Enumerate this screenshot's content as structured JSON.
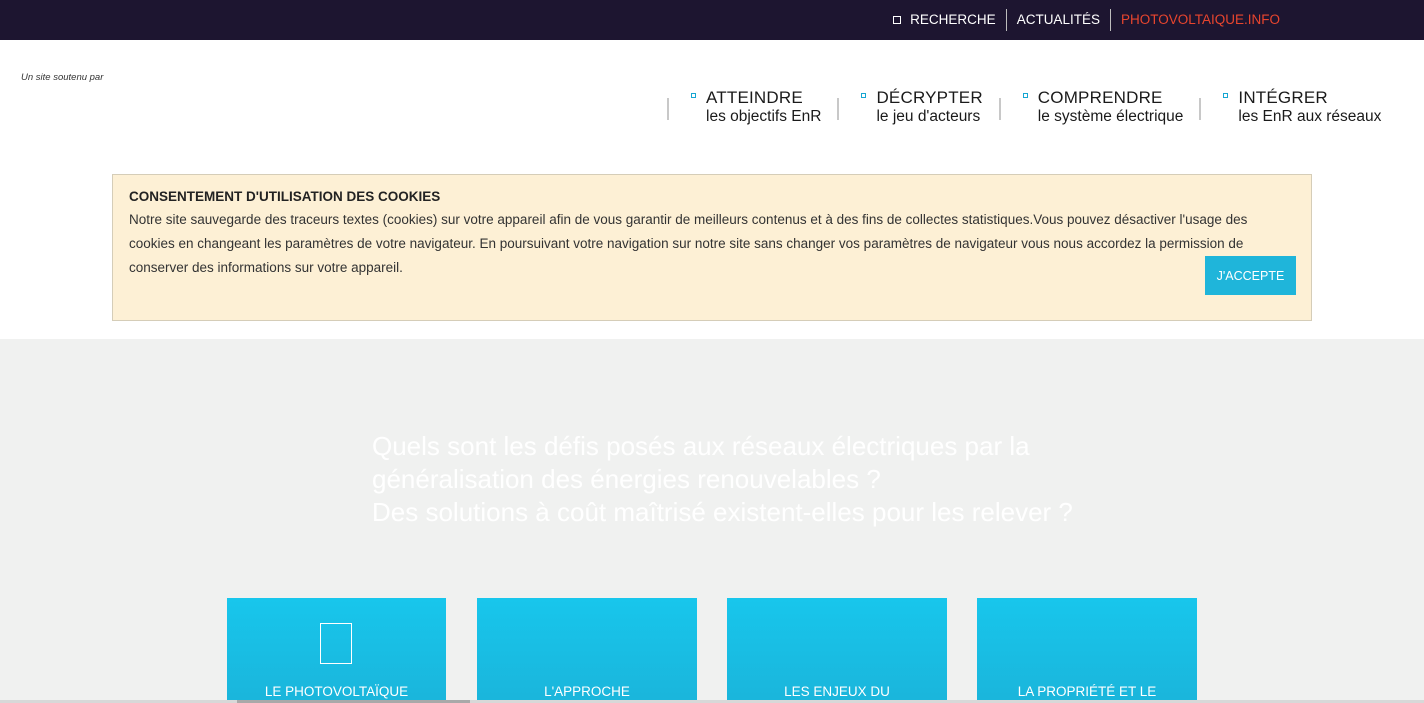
{
  "topbar": {
    "search_label": "RECHERCHE",
    "news_label": "ACTUALITÉS",
    "pv_label": "PHOTOVOLTAIQUE.INFO",
    "accent_color": "#e8452e",
    "bg_color": "#1d1530"
  },
  "header": {
    "supported_text": "Un site soutenu par"
  },
  "nav": {
    "items": [
      {
        "title": "ATTEINDRE",
        "subtitle": "les objectifs EnR"
      },
      {
        "title": "DÉCRYPTER",
        "subtitle": "le jeu d'acteurs"
      },
      {
        "title": "COMPRENDRE",
        "subtitle": "le système électrique"
      },
      {
        "title": "INTÉGRER",
        "subtitle": "les EnR aux réseaux"
      }
    ]
  },
  "cookie": {
    "title": "CONSENTEMENT D'UTILISATION DES COOKIES",
    "text": "Notre site sauvegarde des traceurs textes (cookies) sur votre appareil afin de vous garantir de meilleurs contenus et à des fins de collectes statistiques.Vous pouvez désactiver l'usage des cookies en changeant les paramètres de votre navigateur. En poursuivant votre navigation sur notre site sans changer vos paramètres de navigateur vous nous accordez la permission de conserver des informations sur votre appareil.",
    "accept_label": "J'ACCEPTE",
    "bg_color": "#fdf0d5",
    "button_color": "#1fb5da"
  },
  "hero": {
    "line1": "Quels sont les défis posés aux réseaux électriques par la",
    "line2": "généralisation des énergies renouvelables ?",
    "line3": "Des solutions à coût maîtrisé existent-elles pour les relever ?"
  },
  "cards": [
    {
      "title": "LE PHOTOVOLTAÏQUE"
    },
    {
      "title": "L'APPROCHE"
    },
    {
      "title": "LES ENJEUX DU"
    },
    {
      "title": "LA PROPRIÉTÉ ET LE"
    }
  ],
  "colors": {
    "card_color": "#18c6ec",
    "section_bg": "#f0f1f0"
  }
}
